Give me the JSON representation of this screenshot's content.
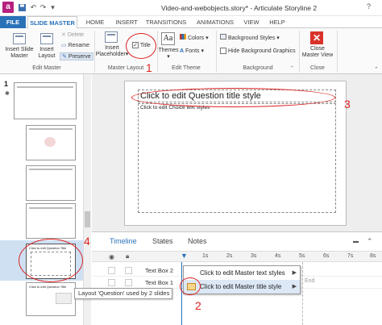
{
  "titlebar": {
    "title": "Video-and-webobjects.story* - Articulate Storyline 2",
    "app_icon_letter": "a",
    "help": "?"
  },
  "tabs": [
    "FILE",
    "SLIDE MASTER",
    "HOME",
    "INSERT",
    "TRANSITIONS",
    "ANIMATIONS",
    "VIEW",
    "HELP"
  ],
  "ribbon": {
    "insert_slide_master": [
      "Insert Slide",
      "Master"
    ],
    "insert_layout": [
      "Insert",
      "Layout"
    ],
    "delete": "Delete",
    "rename": "Rename",
    "preserve": "Preserve",
    "edit_master_group": "Edit Master",
    "insert_placeholder": [
      "Insert",
      "Placeholder"
    ],
    "title_checkbox": "Title",
    "master_layout_group": "Master Layout",
    "themes": "Themes",
    "colors": "Colors",
    "fonts": "Fonts",
    "edit_theme_group": "Edit Theme",
    "background_styles": "Background Styles",
    "hide_background_graphics": "Hide Background Graphics",
    "background_group": "Background",
    "close_master_view": [
      "Close",
      "Master View"
    ],
    "close_group": "Close"
  },
  "slide": {
    "title_placeholder": "Click to edit Question title style",
    "body_placeholder": "Click to edit Choice text styles"
  },
  "left_pane": {
    "slide_number": "1",
    "thumb_title_text": "Click to edit Question Title"
  },
  "timeline": {
    "tabs": [
      "Timeline",
      "States",
      "Notes"
    ],
    "ticks": [
      "1s",
      "2s",
      "3s",
      "4s",
      "5s",
      "6s",
      "7s",
      "8s"
    ],
    "end_label": "End",
    "rows": [
      {
        "name": "Text Box 2"
      },
      {
        "name": "Text Box 1"
      }
    ]
  },
  "context_menu": {
    "items": [
      "Click to edit Master text styles",
      "Click to edit Master title style"
    ]
  },
  "tooltip": "Layout 'Question' used by 2 slides",
  "annotations": [
    "1",
    "2",
    "3",
    "4"
  ],
  "colors": {
    "accent": "#2a72b8",
    "annotation": "#dd2222",
    "storyline_brand": "#b5217e",
    "close_red": "#d9322b"
  }
}
